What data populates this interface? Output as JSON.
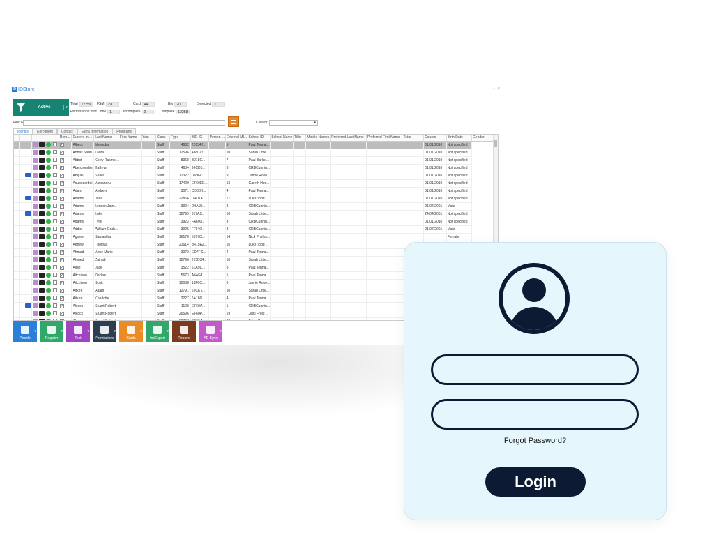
{
  "app": {
    "title": "IDStore",
    "window_controls": [
      "_",
      "▫",
      "×"
    ],
    "filter": {
      "label": "Active"
    },
    "stats": {
      "total_label": "Total",
      "total": "12259",
      "fsm_label": "FSM",
      "fsm": "29",
      "card_label": "Card",
      "card": "44",
      "bio_label": "Bio",
      "bio": "20",
      "selected_label": "Selected",
      "selected": "1",
      "permissions_label": "Permissions: Not Done",
      "permissions": "1",
      "incomplete_label": "Incomplete",
      "incomplete": "0",
      "complete_label": "Complete",
      "complete": "12258"
    },
    "find": {
      "label": "Find Name",
      "value": ""
    },
    "creator": {
      "label": "Creator",
      "value": "▾"
    },
    "tabs": [
      "Identity",
      "Enrolment",
      "Contact",
      "Extra Information",
      "Programs"
    ],
    "columns": [
      "Rem...",
      "Current In ...",
      "Last Name",
      "First Name",
      "Year",
      "Class",
      "Type",
      "BIO ID",
      "Person ...",
      "External MI...",
      "School ID",
      "School Name",
      "Title",
      "Middle Names",
      "Preferred Last Name",
      "Preferred First Name",
      "Tutor",
      "Course",
      "Birth Date",
      "Gender"
    ],
    "rows": [
      {
        "id": false,
        "last": "Albers",
        "first": "Nkenuka",
        "type": "Staff",
        "bio": "4662",
        "person": "216342...",
        "sid": "5",
        "school": "Paul Tenna...",
        "birth": "01/01/2010",
        "gender": "Not specified"
      },
      {
        "id": false,
        "last": "Abbas Sabri",
        "first": "Laura",
        "type": "Staff",
        "bio": "12596",
        "person": "468027...",
        "sid": "10",
        "school": "Sarah Little...",
        "birth": "01/01/2010",
        "gender": "Not specified"
      },
      {
        "id": false,
        "last": "Abbot",
        "first": "Corry Rasmo...",
        "type": "Staff",
        "bio": "8368",
        "person": "B218C...",
        "sid": "7",
        "school": "Paul Barks ...",
        "birth": "01/01/2010",
        "gender": "Not specified"
      },
      {
        "id": false,
        "last": "Abercrombie",
        "first": "Kathryn",
        "type": "Staff",
        "bio": "4634",
        "person": "96CD3...",
        "sid": "3",
        "school": "CRBCunnin...",
        "birth": "01/01/2010",
        "gender": "Not specified"
      },
      {
        "id": true,
        "last": "Abigail",
        "first": "Shaw",
        "type": "Staff",
        "bio": "11322",
        "person": "D69EC...",
        "sid": "9",
        "school": "Jamie Robe...",
        "birth": "01/01/2010",
        "gender": "Not specified"
      },
      {
        "id": false,
        "last": "Acubodarbei",
        "first": "Alexandru",
        "type": "Staff",
        "bio": "17420",
        "person": "EF60EE...",
        "sid": "13",
        "school": "Gareth Hun...",
        "birth": "01/01/2010",
        "gender": "Not specified"
      },
      {
        "id": false,
        "last": "Adam",
        "first": "Andrew",
        "type": "Staff",
        "bio": "3071",
        "person": "CD8D9...",
        "sid": "4",
        "school": "Paul Tenna...",
        "birth": "01/01/2010",
        "gender": "Not specified"
      },
      {
        "id": true,
        "last": "Adams",
        "first": "Jane",
        "type": "Staff",
        "bio": "22866",
        "person": "D4D1E...",
        "sid": "17",
        "school": "Luke Todd ...",
        "birth": "01/01/2010",
        "gender": "Not specified"
      },
      {
        "id": false,
        "last": "Adams",
        "first": "Lennox Jam...",
        "type": "Staff",
        "bio": "3924",
        "person": "D9A15...",
        "sid": "3",
        "school": "CRBCunnin...",
        "birth": "21/04/2001",
        "gender": "Male"
      },
      {
        "id": true,
        "last": "Adams",
        "first": "Luke",
        "type": "Staff",
        "bio": "12799",
        "person": "677A1...",
        "sid": "10",
        "school": "Sarah Little...",
        "birth": "24/04/2001",
        "gender": "Not specified"
      },
      {
        "id": false,
        "last": "Adams",
        "first": "Tyler",
        "type": "Staff",
        "bio": "3923",
        "person": "FA600...",
        "sid": "3",
        "school": "CRBCunnin...",
        "birth": "01/01/2010",
        "gender": "Not specified"
      },
      {
        "id": false,
        "last": "Addie",
        "first": "William Grah...",
        "type": "Staff",
        "bio": "3925",
        "person": "F7940...",
        "sid": "3",
        "school": "CRBCunnin...",
        "birth": "21/07/2001",
        "gender": "Male"
      },
      {
        "id": false,
        "last": "Agnew",
        "first": "Samantha",
        "type": "Staff",
        "bio": "16178",
        "person": "5997C...",
        "sid": "14",
        "school": "Nick Phelps...",
        "birth": "",
        "gender": "Female"
      },
      {
        "id": false,
        "last": "Agnew",
        "first": "Thomas",
        "type": "Staff",
        "bio": "21614",
        "person": "B415E2...",
        "sid": "16",
        "school": "Luke Todd ...",
        "birth": "",
        "gender": ""
      },
      {
        "id": false,
        "last": "Ahmad",
        "first": "Anne Marie",
        "type": "Staff",
        "bio": "3072",
        "person": "ED7FC...",
        "sid": "4",
        "school": "Paul Tenna...",
        "birth": "",
        "gender": ""
      },
      {
        "id": false,
        "last": "Ahmed",
        "first": "Zainab",
        "type": "Staff",
        "bio": "12796",
        "person": "275D34...",
        "sid": "10",
        "school": "Sarah Little...",
        "birth": "",
        "gender": ""
      },
      {
        "id": false,
        "last": "Airlie",
        "first": "Jack",
        "type": "Staff",
        "bio": "3522",
        "person": "61A9D...",
        "sid": "8",
        "school": "Paul Tenna...",
        "birth": "",
        "gender": ""
      },
      {
        "id": false,
        "last": "Aitchison",
        "first": "Declan",
        "type": "Staff",
        "bio": "5673",
        "person": "A6AFA...",
        "sid": "5",
        "school": "Paul Tenna...",
        "birth": "",
        "gender": ""
      },
      {
        "id": false,
        "last": "Aitchison",
        "first": "Scott",
        "type": "Staff",
        "bio": "10038",
        "person": "12F6C...",
        "sid": "8",
        "school": "Jamie Robe...",
        "birth": "",
        "gender": ""
      },
      {
        "id": false,
        "last": "Aitken",
        "first": "Adam",
        "type": "Staff",
        "bio": "12791",
        "person": "69CE7...",
        "sid": "10",
        "school": "Sarah Little...",
        "birth": "",
        "gender": ""
      },
      {
        "id": false,
        "last": "Aitken",
        "first": "Charlotte",
        "type": "Staff",
        "bio": "3227",
        "person": "6A186...",
        "sid": "4",
        "school": "Paul Tenna...",
        "birth": "",
        "gender": ""
      },
      {
        "id": true,
        "last": "Alcock",
        "first": "Stuart Robert",
        "type": "Staff",
        "bio": "1108",
        "person": "EF60A...",
        "sid": "1",
        "school": "CRBCunnin...",
        "birth": "",
        "gender": ""
      },
      {
        "id": false,
        "last": "Alcock",
        "first": "Stuart Robert",
        "type": "Staff",
        "bio": "26596",
        "person": "EF60A...",
        "sid": "19",
        "school": "Jess Frost ...",
        "birth": "",
        "gender": ""
      },
      {
        "id": false,
        "last": "Alcock",
        "first": "Stuart Robert",
        "type": "Staff",
        "bio": "30707",
        "person": "EF60A...",
        "sid": "23",
        "school": "Brian Howa...",
        "birth": "",
        "gender": ""
      }
    ],
    "toolbar": [
      {
        "label": "People",
        "color": "#2a80d8",
        "arrow": true
      },
      {
        "label": "Register",
        "color": "#2fa86a",
        "arrow": true
      },
      {
        "label": "Test",
        "color": "#a045c2",
        "arrow": true
      },
      {
        "label": "Permissions",
        "color": "#2c3e50",
        "arrow": true
      },
      {
        "label": "Cards",
        "color": "#ea8c23",
        "arrow": true
      },
      {
        "label": "Im/Export",
        "color": "#2fa86a",
        "arrow": true
      },
      {
        "label": "Reports",
        "color": "#7a3b1f",
        "arrow": false
      },
      {
        "label": "AD Sync",
        "color": "#c35ac9",
        "arrow": true
      }
    ]
  },
  "login": {
    "forgot_label": "Forgot Password?",
    "login_label": "Login",
    "colors": {
      "card": "#e6f6fd",
      "ink": "#0c1a33"
    }
  }
}
